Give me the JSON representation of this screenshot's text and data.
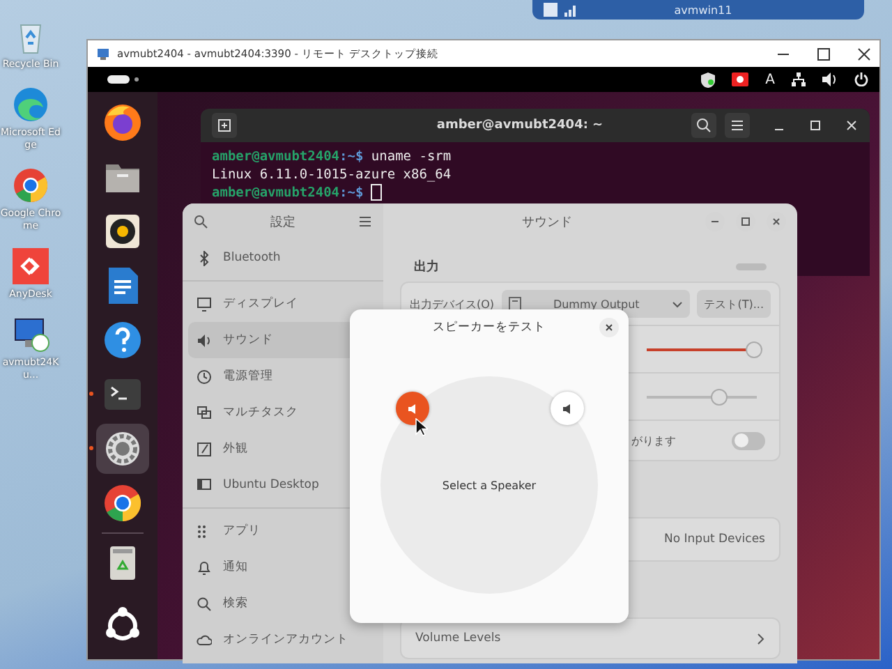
{
  "desktop_icons": [
    {
      "label": "Recycle Bin",
      "kind": "recycle"
    },
    {
      "label": "Microsoft Edge",
      "kind": "edge"
    },
    {
      "label": "Google Chrome",
      "kind": "chrome"
    },
    {
      "label": "AnyDesk",
      "kind": "anydesk"
    },
    {
      "label": "avmubt24Ku...",
      "kind": "rdp"
    }
  ],
  "connection_bar": {
    "title": "avmwin11"
  },
  "rdp_window": {
    "title": "avmubt2404 - avmubt2404:3390 - リモート デスクトップ接続"
  },
  "top_bar": {
    "input_indicator": "A"
  },
  "dock": {
    "apps": [
      {
        "kind": "firefox",
        "running": false,
        "selected": false
      },
      {
        "kind": "files",
        "running": false,
        "selected": false
      },
      {
        "kind": "music",
        "running": false,
        "selected": false
      },
      {
        "kind": "writer",
        "running": false,
        "selected": false
      },
      {
        "kind": "help",
        "running": false,
        "selected": false
      },
      {
        "kind": "terminal",
        "running": true,
        "selected": false
      },
      {
        "kind": "settings",
        "running": true,
        "selected": true
      },
      {
        "kind": "chrome",
        "running": false,
        "selected": false
      },
      {
        "kind": "trash",
        "running": false,
        "selected": false
      },
      {
        "kind": "grid",
        "running": false,
        "selected": false
      }
    ]
  },
  "terminal": {
    "title": "amber@avmubt2404: ~",
    "lines": [
      {
        "kind": "prompt",
        "user": "amber@avmubt2404",
        "path": ":~$",
        "command": "uname -srm"
      },
      {
        "kind": "output",
        "text": "Linux 6.11.0-1015-azure x86_64"
      },
      {
        "kind": "prompt",
        "user": "amber@avmubt2404",
        "path": ":~$"
      }
    ]
  },
  "settings": {
    "sidebar": {
      "title": "設定",
      "groups": [
        [
          {
            "label": "Bluetooth",
            "kind": "bluetooth",
            "selected": false
          }
        ],
        [
          {
            "label": "ディスプレイ",
            "kind": "display",
            "selected": false
          },
          {
            "label": "サウンド",
            "kind": "sound",
            "selected": true
          },
          {
            "label": "電源管理",
            "kind": "power",
            "selected": false
          },
          {
            "label": "マルチタスク",
            "kind": "multitask",
            "selected": false
          },
          {
            "label": "外観",
            "kind": "appearance",
            "selected": false
          },
          {
            "label": "Ubuntu Desktop",
            "kind": "ubuntu",
            "selected": false
          }
        ],
        [
          {
            "label": "アプリ",
            "kind": "apps",
            "selected": false
          },
          {
            "label": "通知",
            "kind": "bell",
            "selected": false
          },
          {
            "label": "検索",
            "kind": "search",
            "selected": false
          },
          {
            "label": "オンラインアカウント",
            "kind": "cloud",
            "selected": false
          }
        ]
      ]
    },
    "main": {
      "title": "サウンド",
      "output_heading": "出力",
      "output_device_label": "出力デバイス(O)",
      "output_device": "Dummy Output",
      "test_button": "テスト(T)...",
      "volume": {
        "level": 0.98
      },
      "balance": {
        "level": 0.66
      },
      "overamp": {
        "text": "がります",
        "on": false
      },
      "input_device": "No Input Devices",
      "volume_levels": "Volume Levels"
    }
  },
  "dialog": {
    "title": "スピーカーをテスト",
    "center_label": "Select a Speaker",
    "speakers": [
      {
        "kind": "left",
        "selected": true
      },
      {
        "kind": "right",
        "selected": false
      }
    ]
  }
}
